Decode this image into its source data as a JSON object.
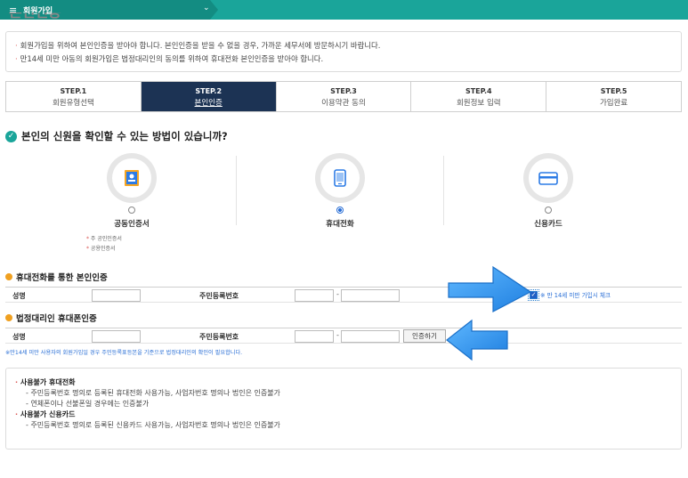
{
  "header": {
    "menu_icon": "hamburger-icon",
    "breadcrumb": "회원가입",
    "chevron": "chevron-down-icon"
  },
  "notice": {
    "line1": "회원가입을 위하여 본인인증을 받아야 합니다. 본인인증을 받을 수 없을 경우, 가까운 세무서에 방문하시기 바랍니다.",
    "line2": "만14세 미만 아동의 회원가입은 법정대리인의 동의를 위하여 휴대전화 본인인증을 받아야 합니다."
  },
  "steps": [
    {
      "num": "STEP.1",
      "name": "회원유형선택",
      "active": false
    },
    {
      "num": "STEP.2",
      "name": "본인인증",
      "active": true
    },
    {
      "num": "STEP.3",
      "name": "이용약관 동의",
      "active": false
    },
    {
      "num": "STEP.4",
      "name": "회원정보 입력",
      "active": false
    },
    {
      "num": "STEP.5",
      "name": "가입완료",
      "active": false
    }
  ],
  "question": "본인의 신원을 확인할 수 있는 방법이 있습니까?",
  "methods": [
    {
      "label": "공동인증서",
      "icon": "certificate-icon",
      "selected": false
    },
    {
      "label": "휴대전화",
      "icon": "mobile-phone-icon",
      "selected": true
    },
    {
      "label": "신용카드",
      "icon": "credit-card-icon",
      "selected": false
    }
  ],
  "cert_notes": [
    "주 공인인증서",
    "공용인증서"
  ],
  "phone_section": {
    "title": "휴대전화를 통한 본인인증",
    "name_label": "성명",
    "id_label": "주민등록번호",
    "name_value": "",
    "id_front": "",
    "id_back": "",
    "dash": "-",
    "age_check_label": "※ 만 14세 미만 가입시 체크",
    "age_checked": true
  },
  "guardian_section": {
    "title": "법정대리인 휴대폰인증",
    "name_label": "성명",
    "id_label": "주민등록번호",
    "name_value": "",
    "id_front": "",
    "id_back": "",
    "dash": "-",
    "auth_button": "인증하기"
  },
  "warning": "※만14세 미만 사용자의 회원가입일 경우 주민등록표등본을 기준으로 법정대리인의 확인이 필요합니다.",
  "info": {
    "title1": "사용불가 휴대전화",
    "item1a": "주민등록번호 명의로 등록된 휴대전화 사용가능, 사업자번호 명의나 법인은 인증불가",
    "item1b": "연체폰이나 선불폰일 경우에는 인증불가",
    "title2": "사용불가 신용카드",
    "item2a": "주민등록번호 명의로 등록된 신용카드 사용가능, 사업자번호 명의나 법인은 인증불가"
  },
  "colors": {
    "topbar": "#1aa59a",
    "step_active": "#1c3354",
    "arrow": "#2f8fe6",
    "section_dot": "#f0a020"
  }
}
